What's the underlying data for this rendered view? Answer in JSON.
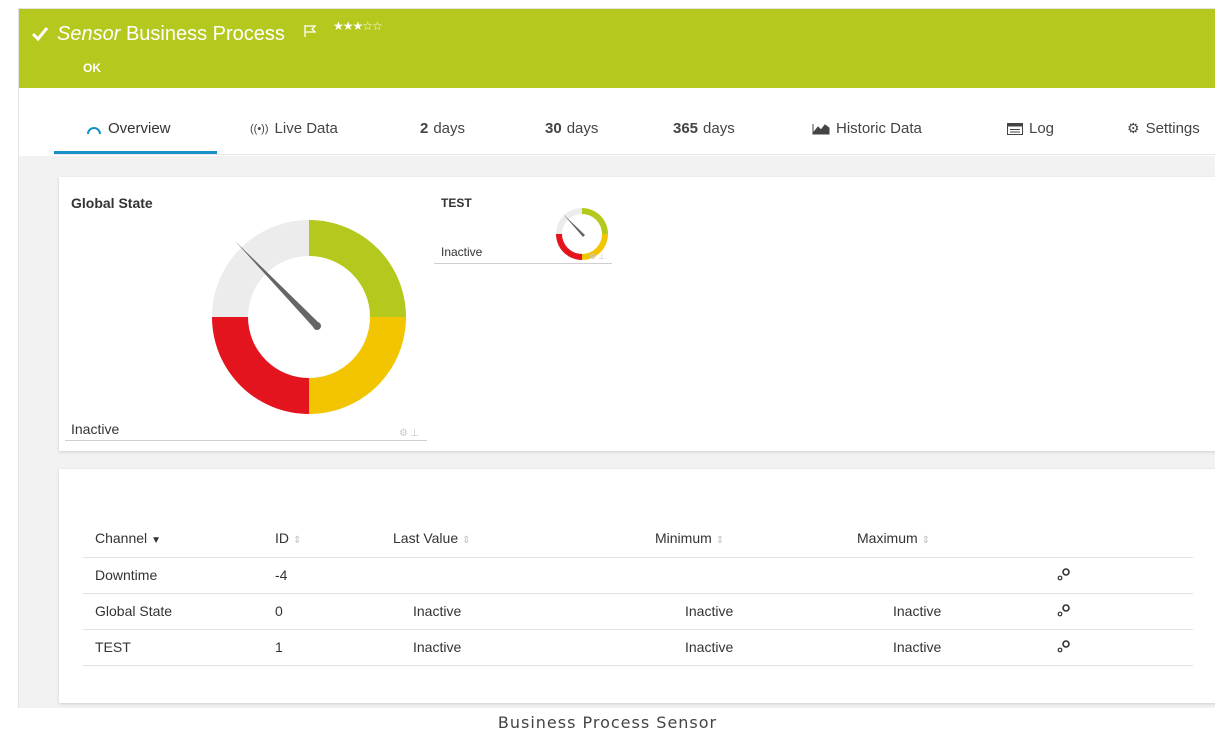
{
  "header": {
    "title_italic": "Sensor",
    "title_rest": "Business Process",
    "stars": "★★★☆☆",
    "status": "OK",
    "bg_color": "#b4c81e"
  },
  "tabs": [
    {
      "icon": "gauge-icon",
      "label": "Overview",
      "active": true
    },
    {
      "icon": "live-data-icon",
      "label": "Live Data"
    },
    {
      "bold": "2",
      "label": "days"
    },
    {
      "bold": "30",
      "label": "days"
    },
    {
      "bold": "365",
      "label": "days"
    },
    {
      "icon": "historic-chart-icon",
      "label": "Historic Data"
    },
    {
      "icon": "log-icon",
      "label": "Log"
    },
    {
      "icon": "gear-icon",
      "label": "Settings"
    }
  ],
  "gauges": {
    "main": {
      "title": "Global State",
      "value": "Inactive"
    },
    "small": {
      "title": "TEST",
      "value": "Inactive"
    },
    "colors": {
      "green": "#b4c81e",
      "yellow": "#f2c500",
      "red": "#e3141e",
      "grey": "#ececec"
    }
  },
  "table": {
    "headers": {
      "channel": "Channel",
      "id": "ID",
      "last_value": "Last Value",
      "minimum": "Minimum",
      "maximum": "Maximum"
    },
    "rows": [
      {
        "channel": "Downtime",
        "id": "-4",
        "last_value": "",
        "minimum": "",
        "maximum": ""
      },
      {
        "channel": "Global State",
        "id": "0",
        "last_value": "Inactive",
        "minimum": "Inactive",
        "maximum": "Inactive"
      },
      {
        "channel": "TEST",
        "id": "1",
        "last_value": "Inactive",
        "minimum": "Inactive",
        "maximum": "Inactive"
      }
    ]
  },
  "caption": "Business Process Sensor"
}
